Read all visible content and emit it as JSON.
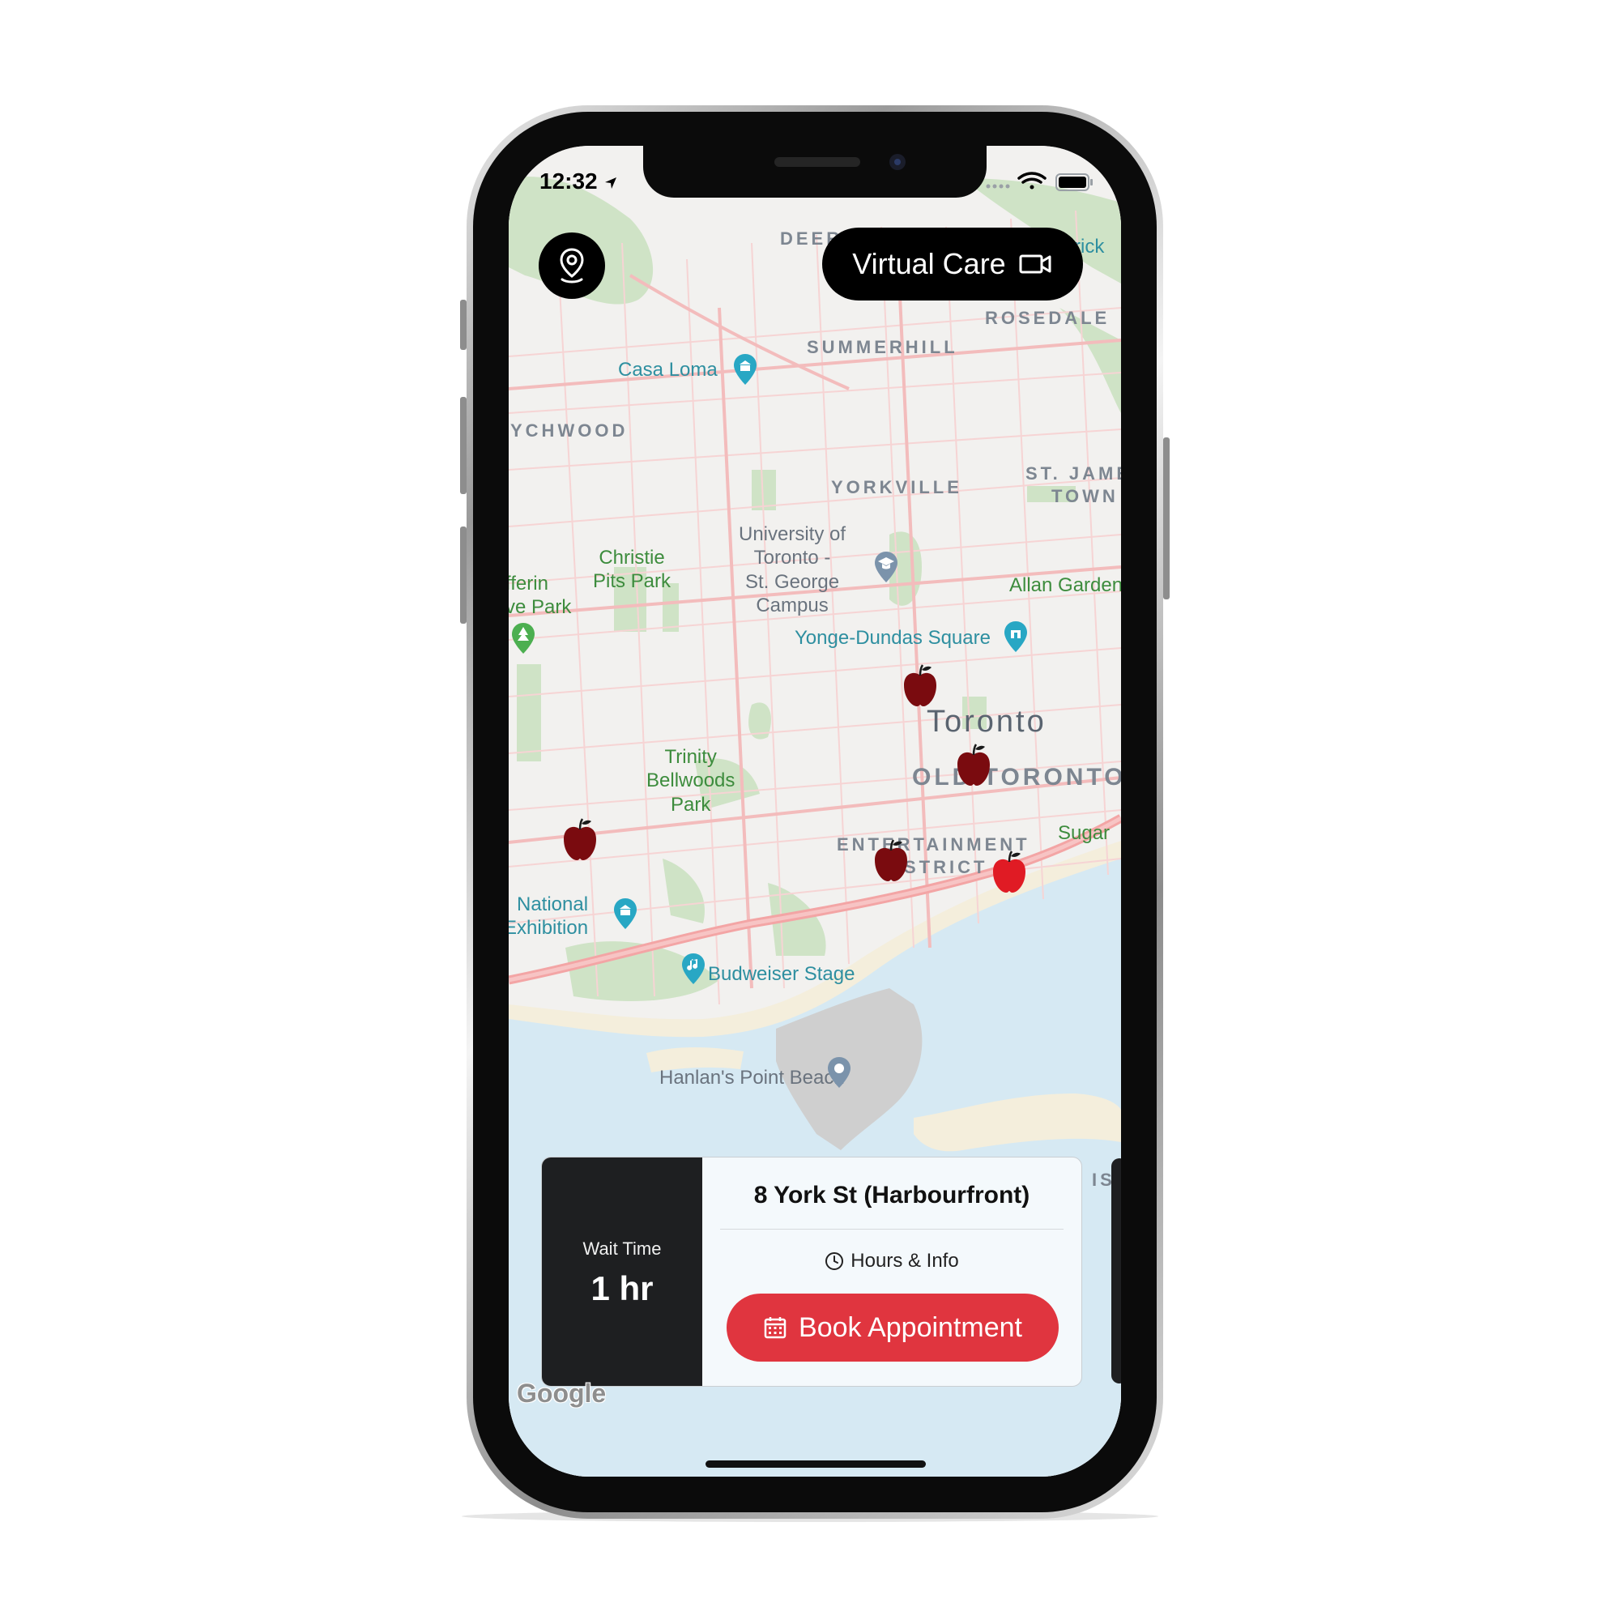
{
  "status_bar": {
    "time": "12:32"
  },
  "top_bar": {
    "location_icon": "location-pin-icon",
    "virtual_care_label": "Virtual Care",
    "virtual_care_icon": "video-camera-icon"
  },
  "map": {
    "districts": {
      "deer": "DEER",
      "rosedale": "ROSEDALE",
      "summerhill": "SUMMERHILL",
      "wychwood": "YCHWOOD",
      "yorkville": "YORKVILLE",
      "st_james_town_1": "ST. JAME",
      "st_james_town_2": "TOWN",
      "old_toronto": "OLD TORONTO",
      "entertainment_1": "ENTERTAINMENT",
      "entertainment_2": "STRICT"
    },
    "city": "Toronto",
    "parks": {
      "christie": [
        "Christie",
        "Pits Park"
      ],
      "dufferin": [
        "fferin",
        "ve Park"
      ],
      "allan": "Allan Garden",
      "trinity": [
        "Trinity",
        "Bellwoods",
        "Park"
      ],
      "sugar": "Sugar"
    },
    "pois": {
      "casa_loma": "Casa Loma",
      "yonge_dundas": "Yonge-Dundas Square",
      "national_exhibition": [
        "National",
        "Exhibition"
      ],
      "budweiser": "Budweiser Stage",
      "rick": "rick"
    },
    "university": [
      "University of",
      "Toronto -",
      "St. George",
      "Campus"
    ],
    "beach": "Hanlan's Point Beach",
    "islands_partial": "IS",
    "attribution": "Google",
    "colors": {
      "land": "#f2f1ef",
      "water": "#d6e9f3",
      "park": "#cfe3c6",
      "road": "#f6caca",
      "highway": "#f3a5a5",
      "marker": "#7a0b0f",
      "marker_selected": "#e01b24"
    }
  },
  "location_card": {
    "wait_label": "Wait Time",
    "wait_value": "1 hr",
    "address": "8 York St (Harbourfront)",
    "hours_label": "Hours & Info",
    "book_label": "Book Appointment",
    "accent": "#e0353f"
  }
}
